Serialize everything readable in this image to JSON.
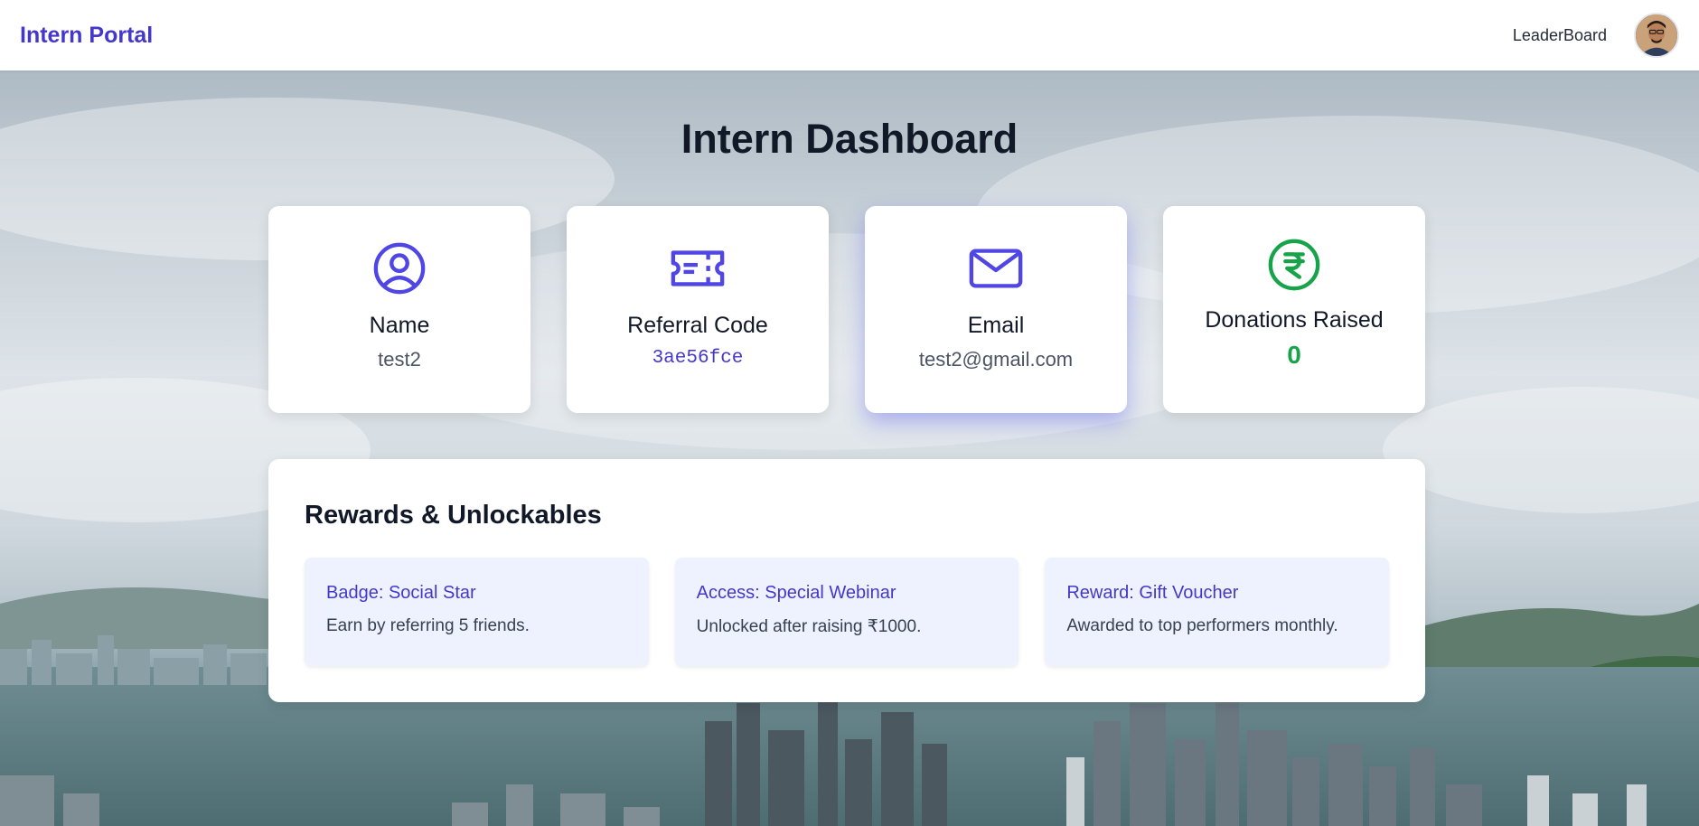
{
  "navbar": {
    "brand": "Intern Portal",
    "leaderboard_label": "LeaderBoard",
    "avatar_icon": "user-avatar-photo"
  },
  "page": {
    "title": "Intern Dashboard"
  },
  "cards": [
    {
      "icon": "user-circle-icon",
      "label": "Name",
      "value": "test2"
    },
    {
      "icon": "ticket-icon",
      "label": "Referral Code",
      "value": "3ae56fce"
    },
    {
      "icon": "mail-icon",
      "label": "Email",
      "value": "test2@gmail.com"
    },
    {
      "icon": "rupee-icon",
      "label": "Donations Raised",
      "value": "0"
    }
  ],
  "rewards": {
    "heading": "Rewards & Unlockables",
    "items": [
      {
        "title": "Badge: Social Star",
        "description": "Earn by referring 5 friends."
      },
      {
        "title": "Access: Special Webinar",
        "description": "Unlocked after raising ₹1000."
      },
      {
        "title": "Reward: Gift Voucher",
        "description": "Awarded to top performers monthly."
      }
    ]
  },
  "colors": {
    "brand": "#4338ca",
    "icon_accent": "#4f46e5",
    "money_green": "#16a34a",
    "reward_bg": "#eef2ff"
  }
}
